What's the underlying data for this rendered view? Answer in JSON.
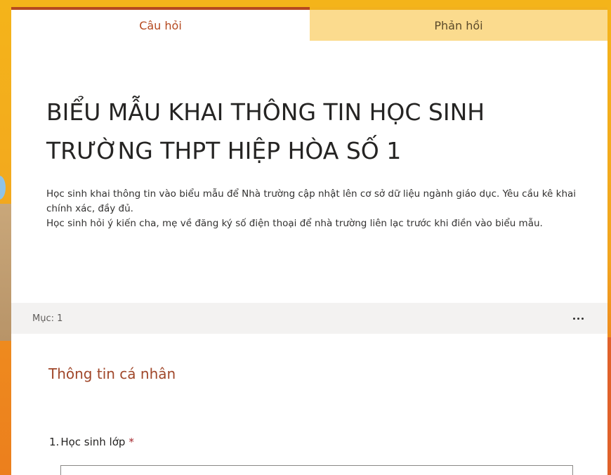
{
  "tabs": {
    "questions_label": "Câu hỏi",
    "responses_label": "Phản hồi"
  },
  "form": {
    "title": "BIỂU MẪU KHAI THÔNG TIN HỌC SINH TRƯỜNG THPT HIỆP HÒA SỐ 1",
    "description_line1": "Học sinh khai thông tin vào biểu mẫu để Nhà trường cập nhật lên cơ sở dữ liệu ngành giáo dục. Yêu cầu kê khai chính xác, đầy đủ.",
    "description_line2": "Học sinh hỏi ý kiến cha, mẹ về đăng ký số điện thoại để nhà trường liên lạc trước khi điền vào biểu mẫu."
  },
  "section": {
    "label": "Mục: 1",
    "more_icon": "more-horizontal-icon",
    "title": "Thông tin cá nhân"
  },
  "questions": [
    {
      "number": "1.",
      "label": "Học sinh lớp",
      "required_mark": "*",
      "value": ""
    }
  ],
  "colors": {
    "accent": "#b5491f",
    "tab_inactive_bg": "#fbdb8e",
    "section_title": "#a0472a",
    "required": "#a4262c",
    "background_top": "#f4b41a",
    "background_bottom": "#ec7f1d"
  }
}
